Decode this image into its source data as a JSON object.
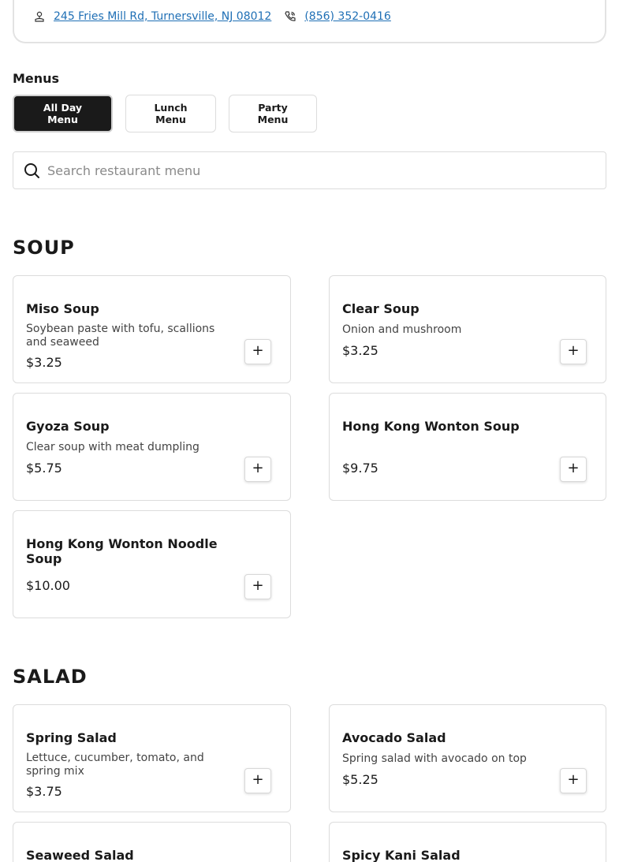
{
  "restaurant": {
    "address": "245 Fries Mill Rd, Turnersville, NJ 08012",
    "phone": "(856) 352-0416"
  },
  "menus": {
    "title": "Menus",
    "tabs": [
      {
        "label": "All Day Menu",
        "active": true
      },
      {
        "label": "Lunch Menu",
        "active": false
      },
      {
        "label": "Party Menu",
        "active": false
      }
    ]
  },
  "search": {
    "placeholder": "Search restaurant menu"
  },
  "sections": [
    {
      "title": "SOUP",
      "items": [
        {
          "name": "Miso Soup",
          "description": "Soybean paste with tofu, scallions and seaweed",
          "price": "$3.25"
        },
        {
          "name": "Clear Soup",
          "description": "Onion and mushroom",
          "price": "$3.25"
        },
        {
          "name": "Gyoza Soup",
          "description": "Clear soup with meat dumpling",
          "price": "$5.75"
        },
        {
          "name": "Hong Kong Wonton Soup",
          "description": "",
          "price": "$9.75"
        },
        {
          "name": "Hong Kong Wonton Noodle Soup",
          "description": "",
          "price": "$10.00"
        }
      ]
    },
    {
      "title": "SALAD",
      "items": [
        {
          "name": "Spring Salad",
          "description": "Lettuce, cucumber, tomato, and spring mix",
          "price": "$3.75"
        },
        {
          "name": "Avocado Salad",
          "description": "Spring salad with avocado on top",
          "price": "$5.25"
        },
        {
          "name": "Seaweed Salad",
          "description": "",
          "price": ""
        },
        {
          "name": "Spicy Kani Salad",
          "description": "",
          "price": ""
        }
      ]
    }
  ],
  "add_button_label": "+",
  "icons": {
    "address": "location-pin-icon",
    "phone": "phone-icon",
    "search": "search-icon",
    "add": "plus-icon"
  },
  "colors": {
    "link": "#1f6fb5",
    "active_tab": "#1a1a1a"
  }
}
